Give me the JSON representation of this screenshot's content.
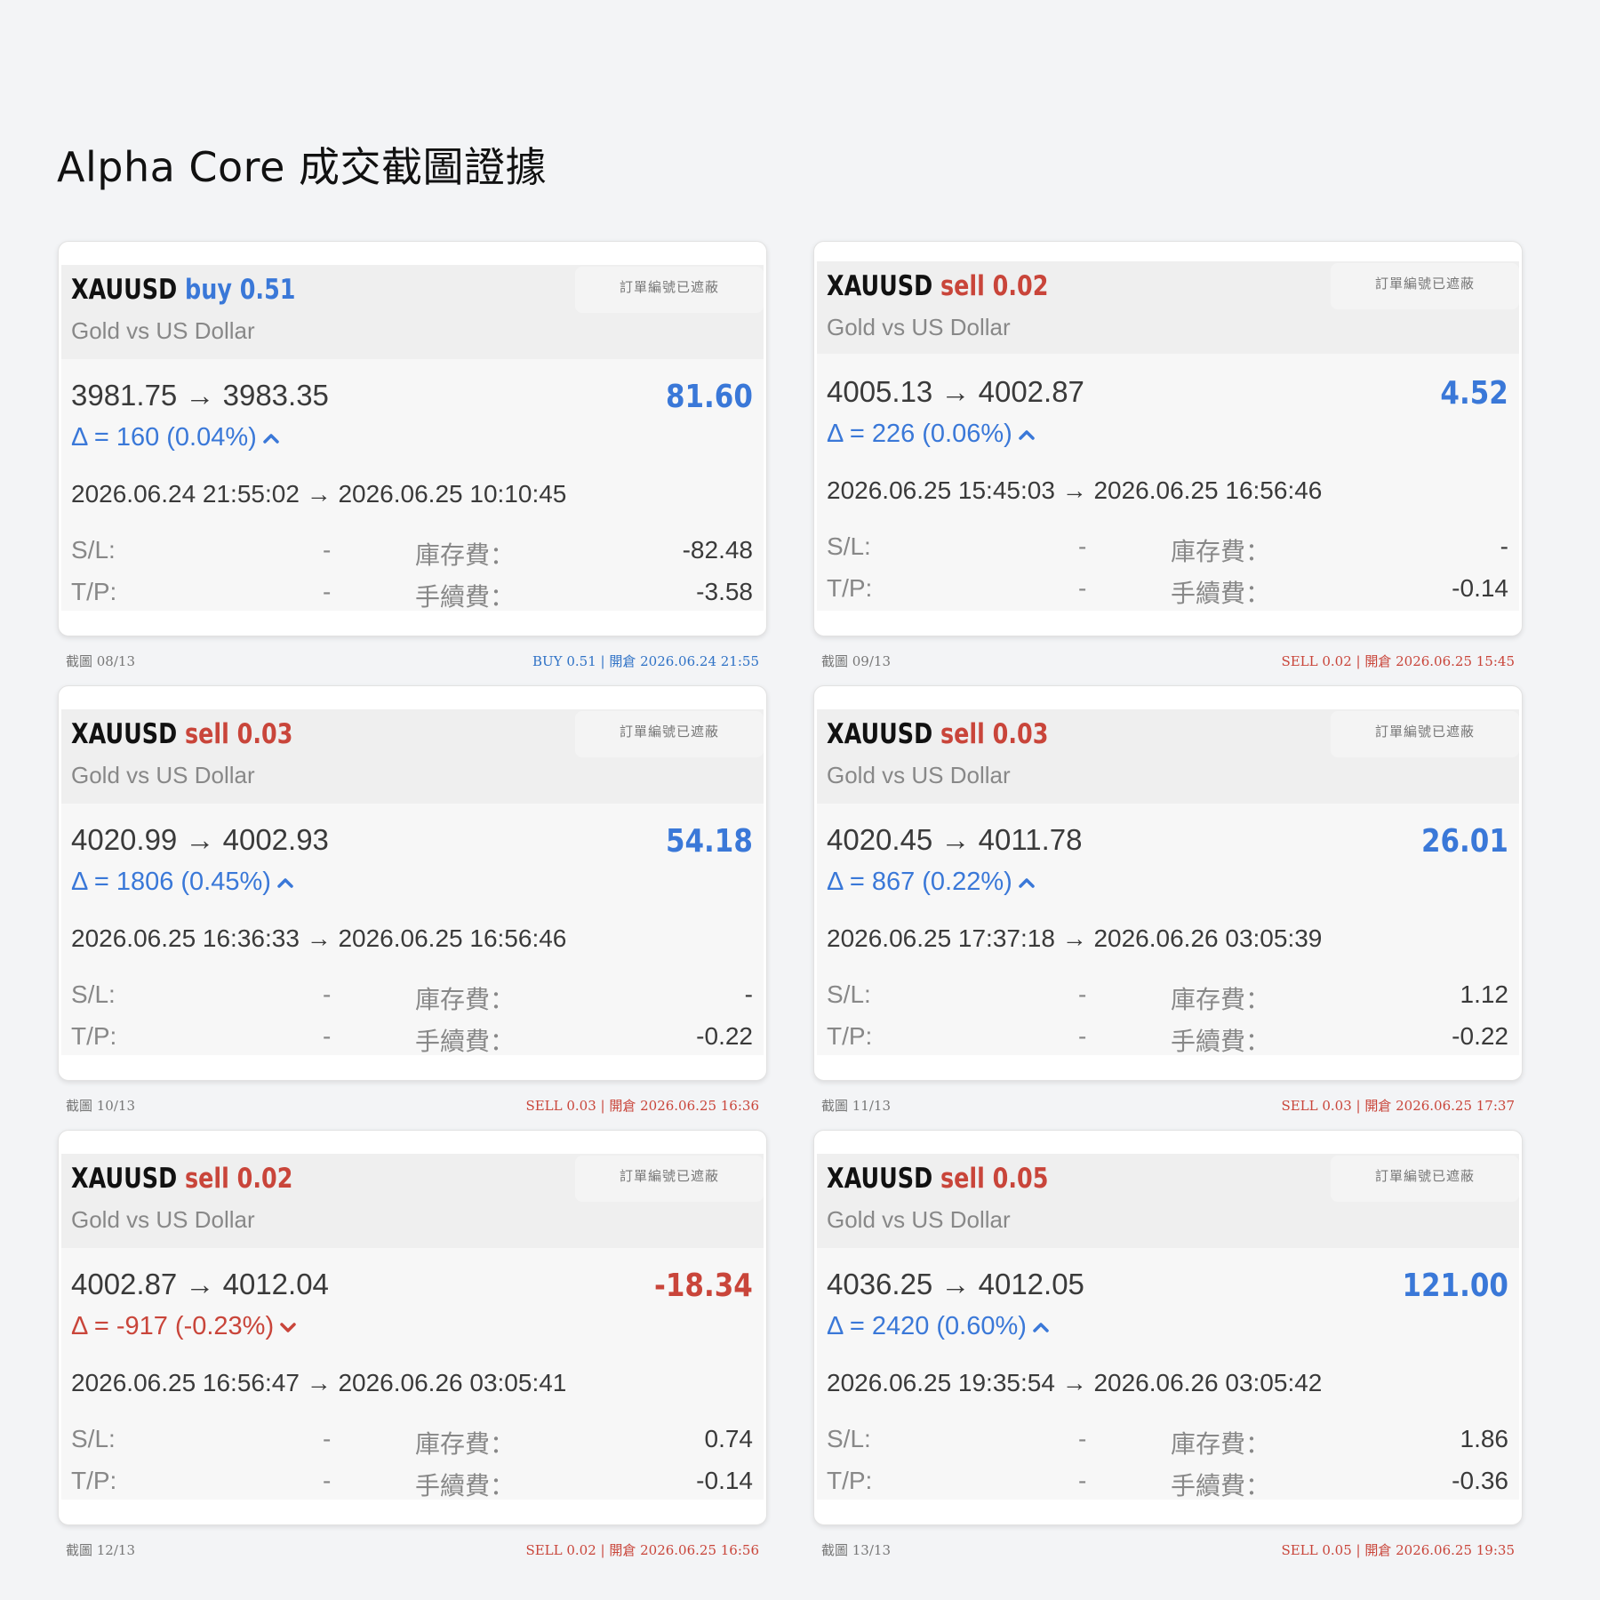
{
  "page": {
    "title": "Alpha Core 成交截圖證據"
  },
  "colors": {
    "buy": "#3a78d8",
    "sell": "#c9453a",
    "background": "#f3f4f6"
  },
  "labels": {
    "masked": "訂單編號已遮蔽",
    "description": "Gold vs US Dollar",
    "sl": "S/L:",
    "tp": "T/P:",
    "swap": "庫存費：",
    "commission": "手續費：",
    "dash": "-"
  },
  "cards": [
    {
      "symbol": "XAUUSD",
      "side": "buy 0.51",
      "side_type": "buy",
      "prices": "3981.75 → 3983.35",
      "profit": "81.60",
      "profit_sign": "pos",
      "delta": "Δ = 160 (0.04%)",
      "direction": "up",
      "times": "2026.06.24 21:55:02 → 2026.06.25 10:10:45",
      "sl": "-",
      "tp": "-",
      "swap": "-82.48",
      "commission": "-3.58",
      "caption_left": "截圖 08/13",
      "caption_right": "BUY 0.51 | 開倉 2026.06.24 21:55"
    },
    {
      "symbol": "XAUUSD",
      "side": "sell 0.02",
      "side_type": "sell",
      "prices": "4005.13 → 4002.87",
      "profit": "4.52",
      "profit_sign": "pos",
      "delta": "Δ = 226 (0.06%)",
      "direction": "up",
      "times": "2026.06.25 15:45:03 → 2026.06.25 16:56:46",
      "sl": "-",
      "tp": "-",
      "swap": "-",
      "commission": "-0.14",
      "caption_left": "截圖 09/13",
      "caption_right": "SELL 0.02 | 開倉 2026.06.25 15:45"
    },
    {
      "symbol": "XAUUSD",
      "side": "sell 0.03",
      "side_type": "sell",
      "prices": "4020.99 → 4002.93",
      "profit": "54.18",
      "profit_sign": "pos",
      "delta": "Δ = 1806 (0.45%)",
      "direction": "up",
      "times": "2026.06.25 16:36:33 → 2026.06.25 16:56:46",
      "sl": "-",
      "tp": "-",
      "swap": "-",
      "commission": "-0.22",
      "caption_left": "截圖 10/13",
      "caption_right": "SELL 0.03 | 開倉 2026.06.25 16:36"
    },
    {
      "symbol": "XAUUSD",
      "side": "sell 0.03",
      "side_type": "sell",
      "prices": "4020.45 → 4011.78",
      "profit": "26.01",
      "profit_sign": "pos",
      "delta": "Δ = 867 (0.22%)",
      "direction": "up",
      "times": "2026.06.25 17:37:18 → 2026.06.26 03:05:39",
      "sl": "-",
      "tp": "-",
      "swap": "1.12",
      "commission": "-0.22",
      "caption_left": "截圖 11/13",
      "caption_right": "SELL 0.03 | 開倉 2026.06.25 17:37"
    },
    {
      "symbol": "XAUUSD",
      "side": "sell 0.02",
      "side_type": "sell",
      "prices": "4002.87 → 4012.04",
      "profit": "-18.34",
      "profit_sign": "neg",
      "delta": "Δ = -917 (-0.23%)",
      "direction": "down",
      "times": "2026.06.25 16:56:47 → 2026.06.26 03:05:41",
      "sl": "-",
      "tp": "-",
      "swap": "0.74",
      "commission": "-0.14",
      "caption_left": "截圖 12/13",
      "caption_right": "SELL 0.02 | 開倉 2026.06.25 16:56"
    },
    {
      "symbol": "XAUUSD",
      "side": "sell 0.05",
      "side_type": "sell",
      "prices": "4036.25 → 4012.05",
      "profit": "121.00",
      "profit_sign": "pos",
      "delta": "Δ = 2420 (0.60%)",
      "direction": "up",
      "times": "2026.06.25 19:35:54 → 2026.06.26 03:05:42",
      "sl": "-",
      "tp": "-",
      "swap": "1.86",
      "commission": "-0.36",
      "caption_left": "截圖 13/13",
      "caption_right": "SELL 0.05 | 開倉 2026.06.25 19:35"
    }
  ]
}
